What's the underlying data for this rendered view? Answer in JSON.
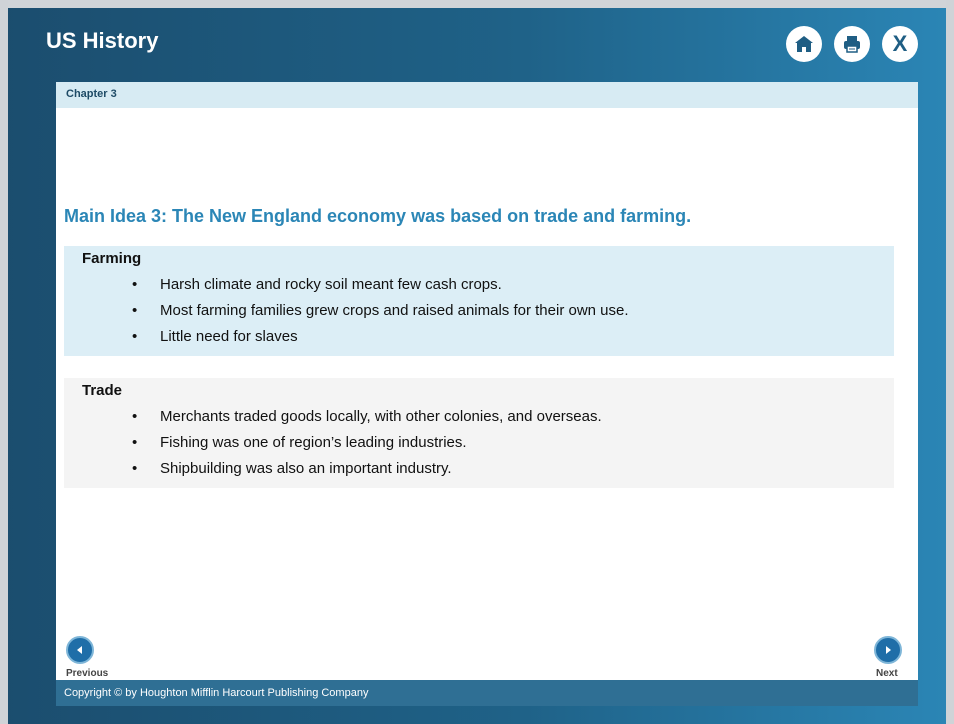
{
  "header": {
    "title": "US History"
  },
  "toolbar": {
    "home_icon": "home-icon",
    "print_icon": "print-icon",
    "close_icon": "close-icon",
    "close_glyph": "X"
  },
  "subheader": {
    "chapter": "Chapter 3"
  },
  "main": {
    "main_idea": "Main Idea 3: The New England economy was based on trade and farming.",
    "sections": [
      {
        "title": "Farming",
        "bullets": [
          "Harsh climate and rocky soil meant few cash crops.",
          "Most farming families grew crops and raised animals for their own use.",
          "Little need for slaves"
        ]
      },
      {
        "title": "Trade",
        "bullets": [
          "Merchants traded goods locally, with other colonies, and overseas.",
          "Fishing was one of region’s leading industries.",
          "Shipbuilding was also an important industry."
        ]
      }
    ]
  },
  "navigation": {
    "previous_label": "Previous",
    "next_label": "Next"
  },
  "footer": {
    "copyright": "Copyright © by Houghton Mifflin Harcourt Publishing Company"
  },
  "colors": {
    "header_dark": "#1b4d6e",
    "header_light": "#2b86b6",
    "main_idea": "#2b86b6",
    "farming_panel": "#dceef6",
    "trade_panel": "#f4f4f4"
  }
}
